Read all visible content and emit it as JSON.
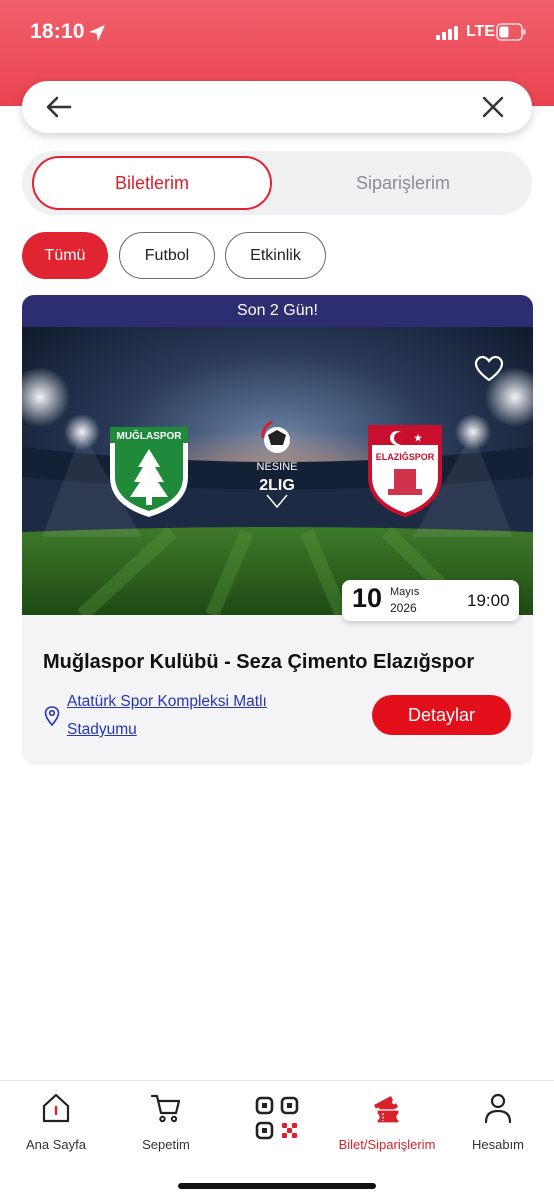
{
  "status_bar": {
    "time": "18:10",
    "network": "LTE"
  },
  "search": {
    "value": "",
    "placeholder": ""
  },
  "segments": {
    "active": "Biletlerim",
    "inactive": "Siparişlerim"
  },
  "filters": [
    {
      "label": "Tümü",
      "selected": true
    },
    {
      "label": "Futbol",
      "selected": false
    },
    {
      "label": "Etkinlik",
      "selected": false
    }
  ],
  "event_card": {
    "banner": "Son 2 Gün!",
    "home_team_logo_text": "MUĞLASPOR",
    "away_team_logo_text": "ELAZIĞSPOR",
    "league_logo_top": "NESINE",
    "league_logo_bottom": "2LIG",
    "date_day": "10",
    "date_month": "Mayıs",
    "date_year": "2026",
    "time": "19:00",
    "title": "Muğlaspor Kulübü - Seza Çimento Elazığspor",
    "venue": "Atatürk Spor Kompleksi Matlı Stadyumu",
    "detail_button": "Detaylar"
  },
  "tabbar": [
    {
      "label": "Ana Sayfa",
      "icon": "home-icon",
      "active": false
    },
    {
      "label": "Sepetim",
      "icon": "cart-icon",
      "active": false
    },
    {
      "label": "",
      "icon": "qr-code-icon",
      "active": false
    },
    {
      "label": "Bilet/Siparişlerim",
      "icon": "ticket-icon",
      "active": true
    },
    {
      "label": "Hesabım",
      "icon": "user-icon",
      "active": false
    }
  ],
  "colors": {
    "accent": "#e02431",
    "banner": "#2d2e72",
    "link": "#2536b5",
    "header": "#ea4350"
  }
}
